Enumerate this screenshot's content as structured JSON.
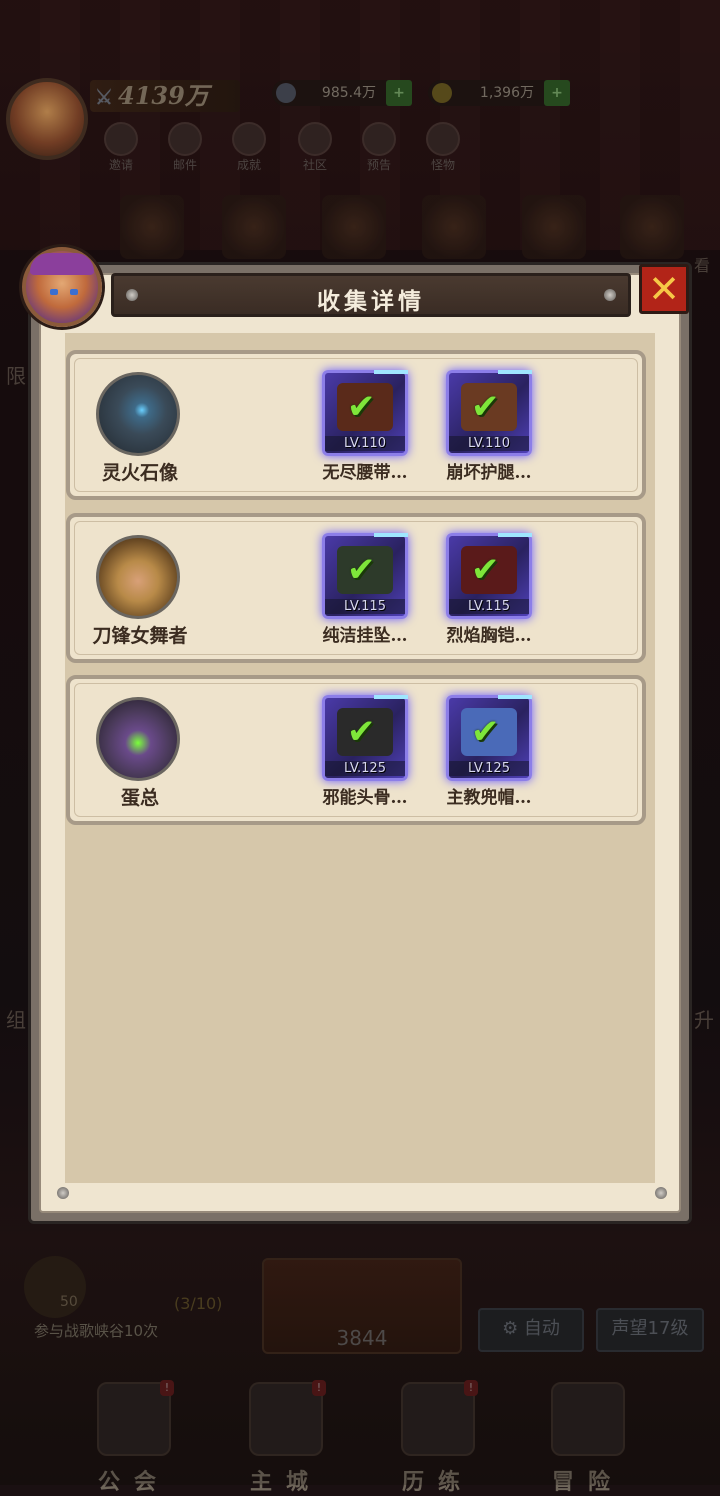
{
  "background": {
    "power": "4139万",
    "currency1": "985.4万",
    "currency2": "1,396万",
    "icons": [
      "邀请",
      "邮件",
      "成就",
      "社区",
      "预告",
      "怪物"
    ],
    "side_left": "限",
    "side_left2": "组",
    "side_right": "升",
    "side_right_top": "看",
    "task": {
      "num": "50",
      "progress": "(3/10)",
      "desc": "参与战歌峡谷10次"
    },
    "big_button_value": "3844",
    "auto_label": "自动",
    "reputation_label": "声望17级",
    "nav": [
      {
        "label": "公会",
        "badge": "!"
      },
      {
        "label": "主城",
        "badge": "!"
      },
      {
        "label": "历练",
        "badge": "!"
      },
      {
        "label": "冒险",
        "badge": ""
      }
    ]
  },
  "modal": {
    "title": "收集详情",
    "close_icon": "close-x-icon",
    "rows": [
      {
        "hero": "灵火石像",
        "hero_color": "#3a4a58",
        "items": [
          {
            "name": "无尽腰带…",
            "level": "LV.110",
            "gear_color": "#5a2a1a",
            "collected": true
          },
          {
            "name": "崩坏护腿…",
            "level": "LV.110",
            "gear_color": "#6a3a22",
            "collected": true
          }
        ]
      },
      {
        "hero": "刀锋女舞者",
        "hero_color": "#b88a48",
        "items": [
          {
            "name": "纯洁挂坠…",
            "level": "LV.115",
            "gear_color": "#2d3a2a",
            "collected": true
          },
          {
            "name": "烈焰胸铠…",
            "level": "LV.115",
            "gear_color": "#5a1a1a",
            "collected": true
          }
        ]
      },
      {
        "hero": "蛋总",
        "hero_color": "#4a5a3a",
        "items": [
          {
            "name": "邪能头骨…",
            "level": "LV.125",
            "gear_color": "#2a2a2a",
            "collected": true
          },
          {
            "name": "主教兜帽…",
            "level": "LV.125",
            "gear_color": "#4a6ab8",
            "collected": true
          }
        ]
      }
    ]
  }
}
